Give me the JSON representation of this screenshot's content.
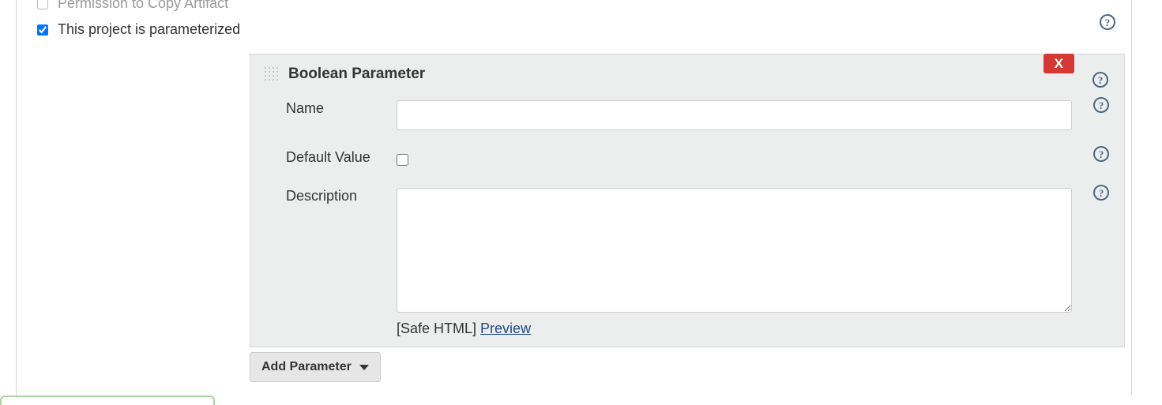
{
  "options": {
    "copy_artifact_label": "Permission to Copy Artifact",
    "parameterized_label": "This project is parameterized",
    "parameterized_checked": true
  },
  "parameter": {
    "type_title": "Boolean Parameter",
    "remove_label": "X",
    "fields": {
      "name_label": "Name",
      "name_value": "",
      "default_value_label": "Default Value",
      "default_value_checked": false,
      "description_label": "Description",
      "description_value": "",
      "description_hint": "[Safe HTML]",
      "preview_label": "Preview"
    }
  },
  "buttons": {
    "add_parameter_label": "Add Parameter"
  }
}
